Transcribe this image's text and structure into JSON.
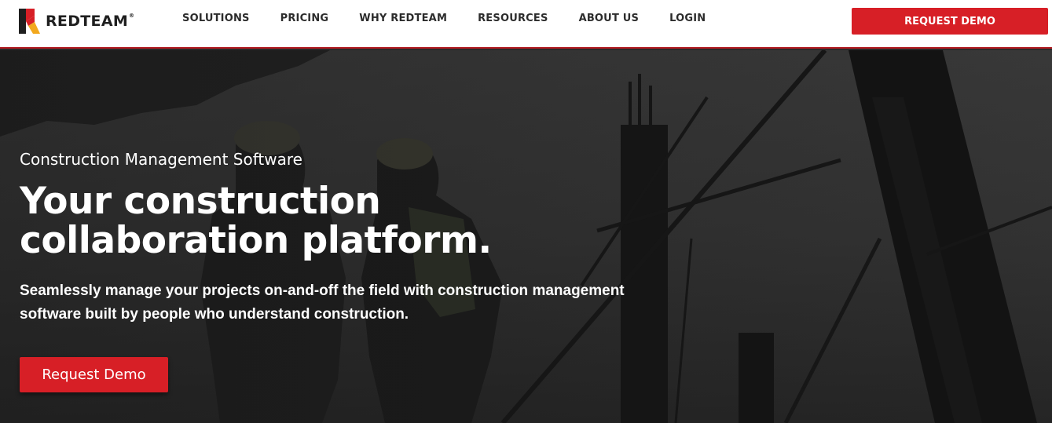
{
  "brand": {
    "name": "REDTEAM",
    "registered_mark": "®",
    "primary_color": "#d71f26",
    "logo_accent_color": "#f2a81d"
  },
  "nav": {
    "items": [
      {
        "label": "SOLUTIONS"
      },
      {
        "label": "PRICING"
      },
      {
        "label": "WHY REDTEAM"
      },
      {
        "label": "RESOURCES"
      },
      {
        "label": "ABOUT US"
      },
      {
        "label": "LOGIN"
      }
    ],
    "cta_label": "REQUEST DEMO"
  },
  "hero": {
    "eyebrow": "Construction Management Software",
    "headline_line1": "Your construction",
    "headline_line2": "collaboration platform.",
    "subtext": "Seamlessly manage your projects on-and-off the field with construction management software built by people who understand construction.",
    "cta_label": "Request Demo",
    "background_image": "silhouetted-construction-workers-and-scaffolding"
  }
}
